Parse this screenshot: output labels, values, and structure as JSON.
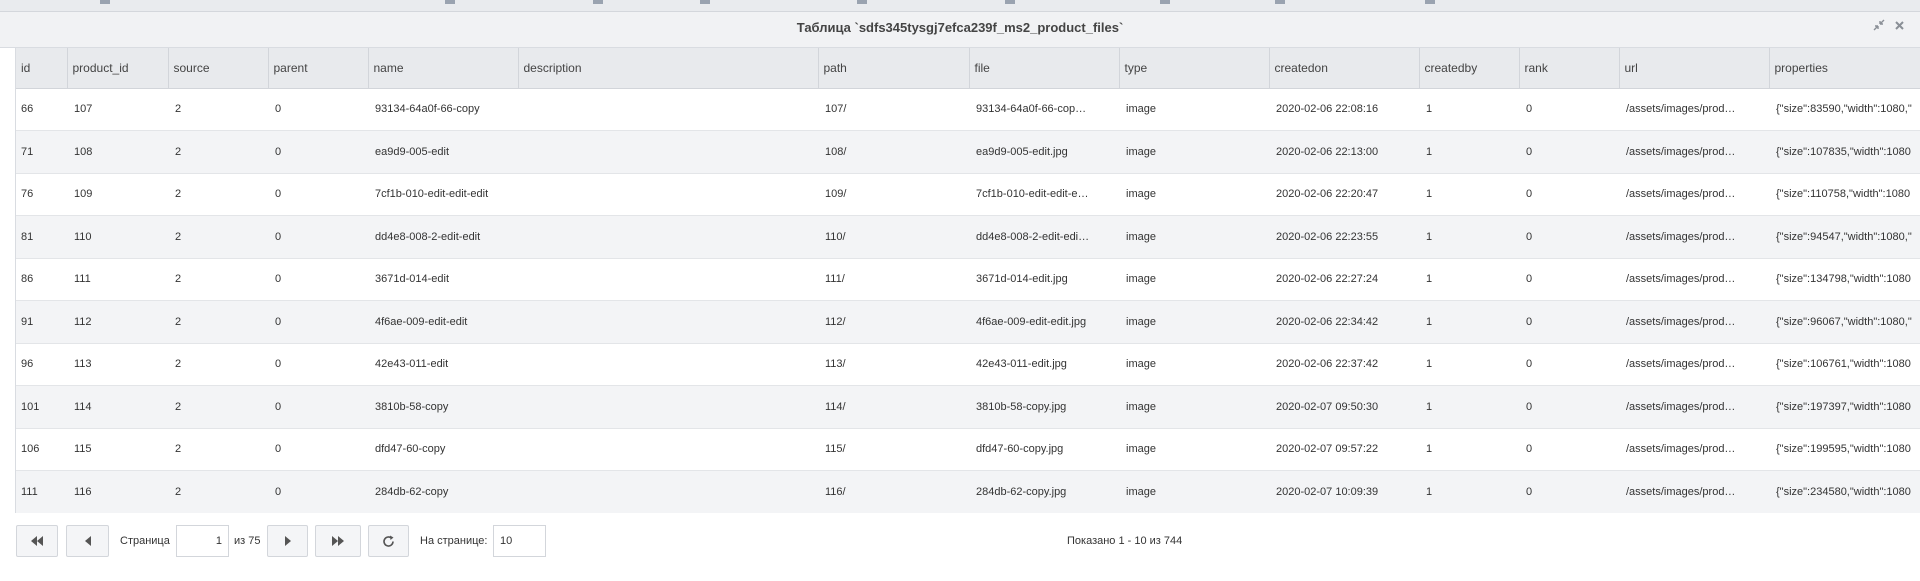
{
  "window": {
    "title": "Таблица `sdfs345tysgj7efca239f_ms2_product_files`"
  },
  "columns": [
    "id",
    "product_id",
    "source",
    "parent",
    "name",
    "description",
    "path",
    "file",
    "type",
    "createdon",
    "createdby",
    "rank",
    "url",
    "properties"
  ],
  "rows": [
    [
      "66",
      "107",
      "2",
      "0",
      "93134-64a0f-66-copy",
      "",
      "107/",
      "93134-64a0f-66-cop…",
      "image",
      "2020-02-06 22:08:16",
      "1",
      "0",
      "/assets/images/prod…",
      "{\"size\":83590,\"width\":1080,\""
    ],
    [
      "71",
      "108",
      "2",
      "0",
      "ea9d9-005-edit",
      "",
      "108/",
      "ea9d9-005-edit.jpg",
      "image",
      "2020-02-06 22:13:00",
      "1",
      "0",
      "/assets/images/prod…",
      "{\"size\":107835,\"width\":1080"
    ],
    [
      "76",
      "109",
      "2",
      "0",
      "7cf1b-010-edit-edit-edit",
      "",
      "109/",
      "7cf1b-010-edit-edit-e…",
      "image",
      "2020-02-06 22:20:47",
      "1",
      "0",
      "/assets/images/prod…",
      "{\"size\":110758,\"width\":1080"
    ],
    [
      "81",
      "110",
      "2",
      "0",
      "dd4e8-008-2-edit-edit",
      "",
      "110/",
      "dd4e8-008-2-edit-edi…",
      "image",
      "2020-02-06 22:23:55",
      "1",
      "0",
      "/assets/images/prod…",
      "{\"size\":94547,\"width\":1080,\""
    ],
    [
      "86",
      "111",
      "2",
      "0",
      "3671d-014-edit",
      "",
      "111/",
      "3671d-014-edit.jpg",
      "image",
      "2020-02-06 22:27:24",
      "1",
      "0",
      "/assets/images/prod…",
      "{\"size\":134798,\"width\":1080"
    ],
    [
      "91",
      "112",
      "2",
      "0",
      "4f6ae-009-edit-edit",
      "",
      "112/",
      "4f6ae-009-edit-edit.jpg",
      "image",
      "2020-02-06 22:34:42",
      "1",
      "0",
      "/assets/images/prod…",
      "{\"size\":96067,\"width\":1080,\""
    ],
    [
      "96",
      "113",
      "2",
      "0",
      "42e43-011-edit",
      "",
      "113/",
      "42e43-011-edit.jpg",
      "image",
      "2020-02-06 22:37:42",
      "1",
      "0",
      "/assets/images/prod…",
      "{\"size\":106761,\"width\":1080"
    ],
    [
      "101",
      "114",
      "2",
      "0",
      "3810b-58-copy",
      "",
      "114/",
      "3810b-58-copy.jpg",
      "image",
      "2020-02-07 09:50:30",
      "1",
      "0",
      "/assets/images/prod…",
      "{\"size\":197397,\"width\":1080"
    ],
    [
      "106",
      "115",
      "2",
      "0",
      "dfd47-60-copy",
      "",
      "115/",
      "dfd47-60-copy.jpg",
      "image",
      "2020-02-07 09:57:22",
      "1",
      "0",
      "/assets/images/prod…",
      "{\"size\":199595,\"width\":1080"
    ],
    [
      "111",
      "116",
      "2",
      "0",
      "284db-62-copy",
      "",
      "116/",
      "284db-62-copy.jpg",
      "image",
      "2020-02-07 10:09:39",
      "1",
      "0",
      "/assets/images/prod…",
      "{\"size\":234580,\"width\":1080"
    ]
  ],
  "pager": {
    "page_label": "Страница",
    "page_value": "1",
    "of_label": "из 75",
    "per_page_label": "На странице:",
    "per_page_value": "10",
    "info": "Показано 1 - 10 из 744"
  },
  "icons": {
    "first": "double-chevron-left-icon",
    "prev": "triangle-left-icon",
    "next": "triangle-right-icon",
    "last": "double-chevron-right-icon",
    "refresh": "refresh-icon",
    "collapse": "collapse-icon",
    "close": "close-icon"
  }
}
